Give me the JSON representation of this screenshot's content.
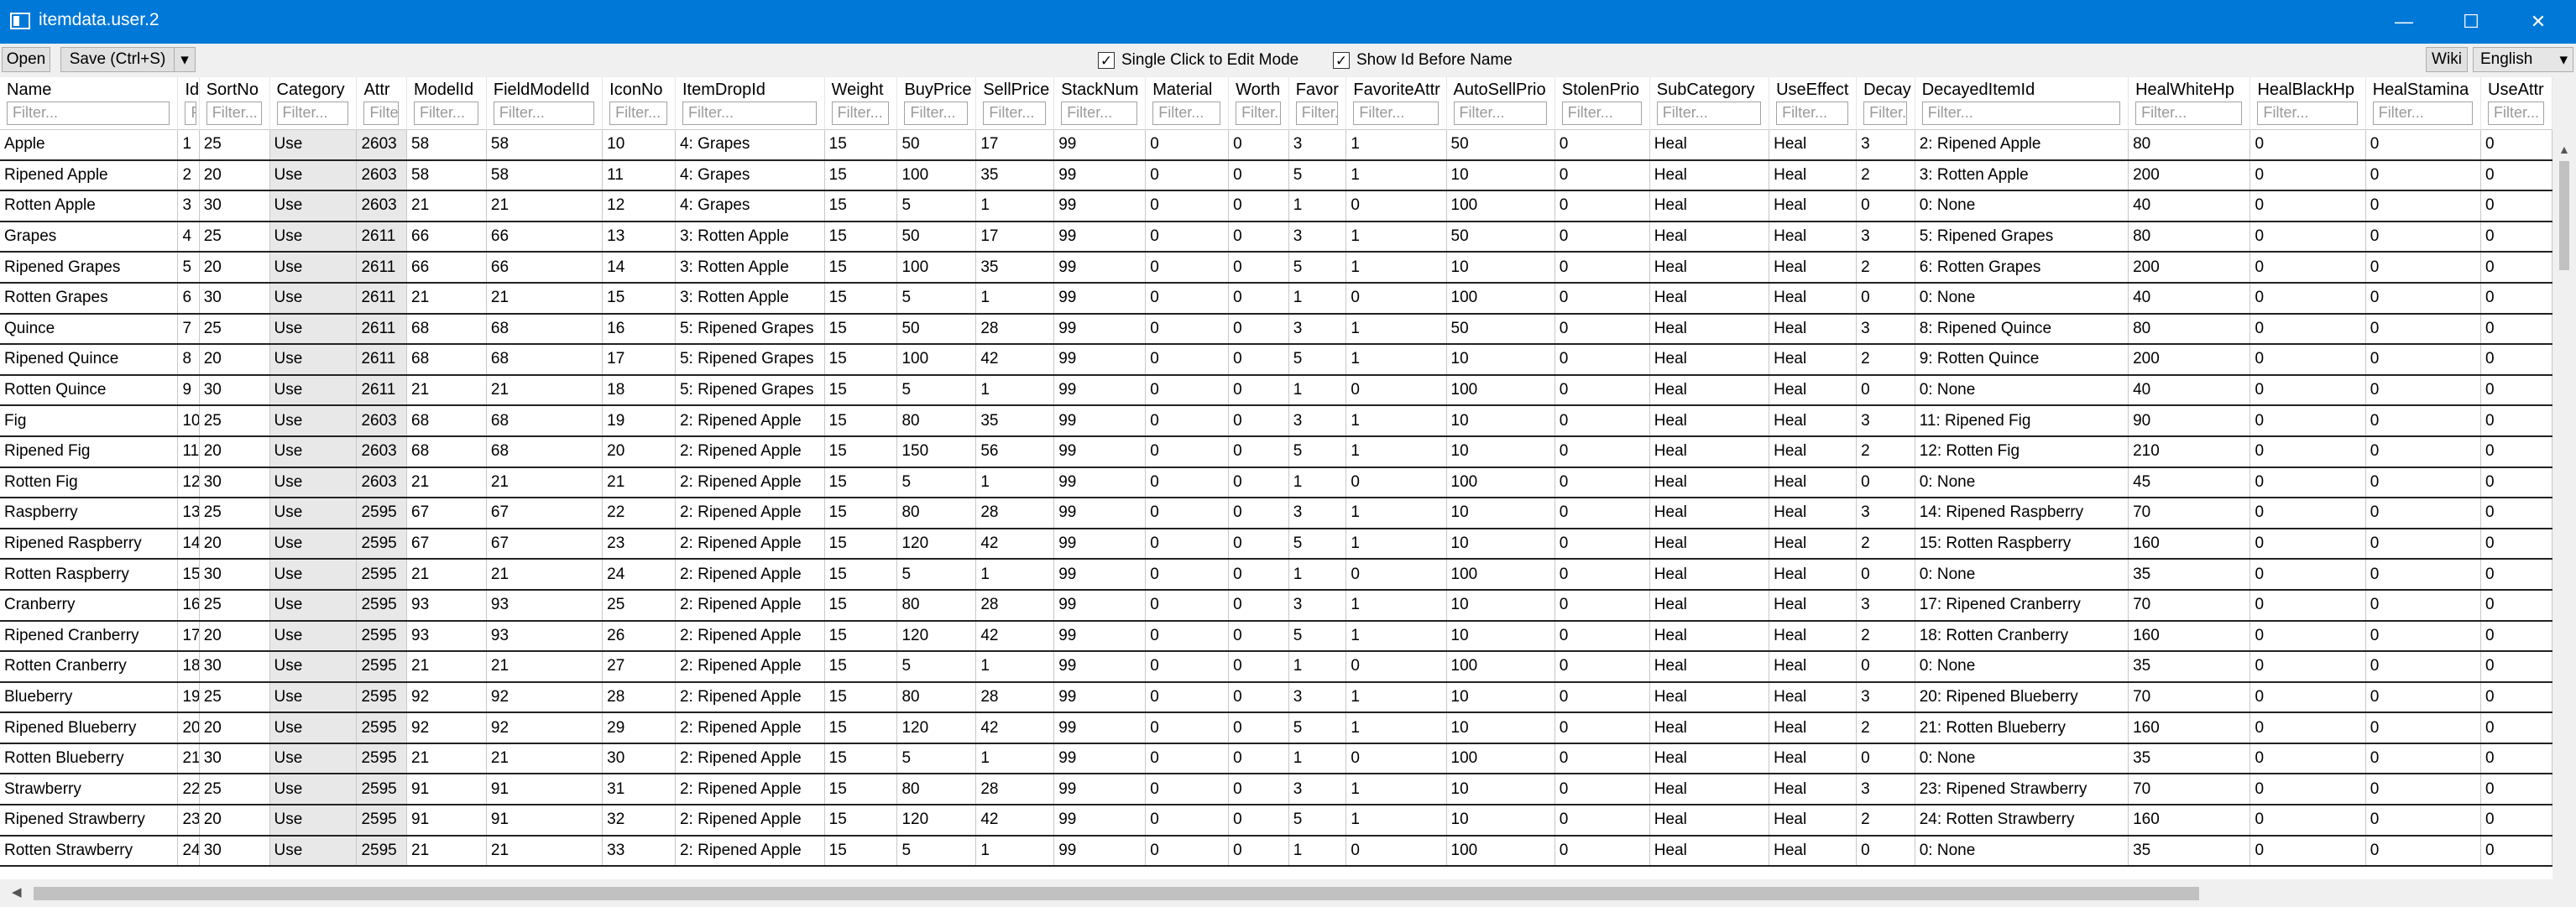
{
  "window": {
    "title": "itemdata.user.2",
    "minimize_icon": "minimize-icon",
    "maximize_icon": "maximize-icon",
    "close_icon": "close-icon",
    "minimize": "—",
    "maximize": "☐",
    "close": "✕"
  },
  "toolbar": {
    "open_label": "Open",
    "save_label": "Save (Ctrl+S)",
    "save_dropdown": "▾",
    "single_click_label": "Single Click to Edit Mode",
    "single_click_checked": "✓",
    "show_id_label": "Show Id Before Name",
    "show_id_checked": "✓",
    "wiki_label": "Wiki",
    "language_value": "English",
    "language_dropdown": "▾"
  },
  "grid": {
    "filter_placeholder": "Filter...",
    "columns": [
      "Name",
      "Id",
      "SortNo",
      "Category",
      "Attr",
      "ModelId",
      "FieldModelId",
      "IconNo",
      "ItemDropId",
      "Weight",
      "BuyPrice",
      "SellPrice",
      "StackNum",
      "Material",
      "Worth",
      "Favor",
      "FavoriteAttr",
      "AutoSellPrio",
      "StolenPrio",
      "SubCategory",
      "UseEffect",
      "Decay",
      "DecayedItemId",
      "HealWhiteHp",
      "HealBlackHp",
      "HealStamina",
      "UseAttr"
    ],
    "rows": [
      [
        "Apple",
        "1",
        "25",
        "Use",
        "2603",
        "58",
        "58",
        "10",
        "4: Grapes",
        "15",
        "50",
        "17",
        "99",
        "0",
        "0",
        "3",
        "1",
        "50",
        "0",
        "Heal",
        "Heal",
        "3",
        "2: Ripened Apple",
        "80",
        "0",
        "0",
        "0"
      ],
      [
        "Ripened Apple",
        "2",
        "20",
        "Use",
        "2603",
        "58",
        "58",
        "11",
        "4: Grapes",
        "15",
        "100",
        "35",
        "99",
        "0",
        "0",
        "5",
        "1",
        "10",
        "0",
        "Heal",
        "Heal",
        "2",
        "3: Rotten Apple",
        "200",
        "0",
        "0",
        "0"
      ],
      [
        "Rotten Apple",
        "3",
        "30",
        "Use",
        "2603",
        "21",
        "21",
        "12",
        "4: Grapes",
        "15",
        "5",
        "1",
        "99",
        "0",
        "0",
        "1",
        "0",
        "100",
        "0",
        "Heal",
        "Heal",
        "0",
        "0: None",
        "40",
        "0",
        "0",
        "0"
      ],
      [
        "Grapes",
        "4",
        "25",
        "Use",
        "2611",
        "66",
        "66",
        "13",
        "3: Rotten Apple",
        "15",
        "50",
        "17",
        "99",
        "0",
        "0",
        "3",
        "1",
        "50",
        "0",
        "Heal",
        "Heal",
        "3",
        "5: Ripened Grapes",
        "80",
        "0",
        "0",
        "0"
      ],
      [
        "Ripened Grapes",
        "5",
        "20",
        "Use",
        "2611",
        "66",
        "66",
        "14",
        "3: Rotten Apple",
        "15",
        "100",
        "35",
        "99",
        "0",
        "0",
        "5",
        "1",
        "10",
        "0",
        "Heal",
        "Heal",
        "2",
        "6: Rotten Grapes",
        "200",
        "0",
        "0",
        "0"
      ],
      [
        "Rotten Grapes",
        "6",
        "30",
        "Use",
        "2611",
        "21",
        "21",
        "15",
        "3: Rotten Apple",
        "15",
        "5",
        "1",
        "99",
        "0",
        "0",
        "1",
        "0",
        "100",
        "0",
        "Heal",
        "Heal",
        "0",
        "0: None",
        "40",
        "0",
        "0",
        "0"
      ],
      [
        "Quince",
        "7",
        "25",
        "Use",
        "2611",
        "68",
        "68",
        "16",
        "5: Ripened Grapes",
        "15",
        "50",
        "28",
        "99",
        "0",
        "0",
        "3",
        "1",
        "50",
        "0",
        "Heal",
        "Heal",
        "3",
        "8: Ripened Quince",
        "80",
        "0",
        "0",
        "0"
      ],
      [
        "Ripened Quince",
        "8",
        "20",
        "Use",
        "2611",
        "68",
        "68",
        "17",
        "5: Ripened Grapes",
        "15",
        "100",
        "42",
        "99",
        "0",
        "0",
        "5",
        "1",
        "10",
        "0",
        "Heal",
        "Heal",
        "2",
        "9: Rotten Quince",
        "200",
        "0",
        "0",
        "0"
      ],
      [
        "Rotten Quince",
        "9",
        "30",
        "Use",
        "2611",
        "21",
        "21",
        "18",
        "5: Ripened Grapes",
        "15",
        "5",
        "1",
        "99",
        "0",
        "0",
        "1",
        "0",
        "100",
        "0",
        "Heal",
        "Heal",
        "0",
        "0: None",
        "40",
        "0",
        "0",
        "0"
      ],
      [
        "Fig",
        "10",
        "25",
        "Use",
        "2603",
        "68",
        "68",
        "19",
        "2: Ripened Apple",
        "15",
        "80",
        "35",
        "99",
        "0",
        "0",
        "3",
        "1",
        "10",
        "0",
        "Heal",
        "Heal",
        "3",
        "11: Ripened Fig",
        "90",
        "0",
        "0",
        "0"
      ],
      [
        "Ripened Fig",
        "11",
        "20",
        "Use",
        "2603",
        "68",
        "68",
        "20",
        "2: Ripened Apple",
        "15",
        "150",
        "56",
        "99",
        "0",
        "0",
        "5",
        "1",
        "10",
        "0",
        "Heal",
        "Heal",
        "2",
        "12: Rotten Fig",
        "210",
        "0",
        "0",
        "0"
      ],
      [
        "Rotten Fig",
        "12",
        "30",
        "Use",
        "2603",
        "21",
        "21",
        "21",
        "2: Ripened Apple",
        "15",
        "5",
        "1",
        "99",
        "0",
        "0",
        "1",
        "0",
        "100",
        "0",
        "Heal",
        "Heal",
        "0",
        "0: None",
        "45",
        "0",
        "0",
        "0"
      ],
      [
        "Raspberry",
        "13",
        "25",
        "Use",
        "2595",
        "67",
        "67",
        "22",
        "2: Ripened Apple",
        "15",
        "80",
        "28",
        "99",
        "0",
        "0",
        "3",
        "1",
        "10",
        "0",
        "Heal",
        "Heal",
        "3",
        "14: Ripened Raspberry",
        "70",
        "0",
        "0",
        "0"
      ],
      [
        "Ripened Raspberry",
        "14",
        "20",
        "Use",
        "2595",
        "67",
        "67",
        "23",
        "2: Ripened Apple",
        "15",
        "120",
        "42",
        "99",
        "0",
        "0",
        "5",
        "1",
        "10",
        "0",
        "Heal",
        "Heal",
        "2",
        "15: Rotten Raspberry",
        "160",
        "0",
        "0",
        "0"
      ],
      [
        "Rotten Raspberry",
        "15",
        "30",
        "Use",
        "2595",
        "21",
        "21",
        "24",
        "2: Ripened Apple",
        "15",
        "5",
        "1",
        "99",
        "0",
        "0",
        "1",
        "0",
        "100",
        "0",
        "Heal",
        "Heal",
        "0",
        "0: None",
        "35",
        "0",
        "0",
        "0"
      ],
      [
        "Cranberry",
        "16",
        "25",
        "Use",
        "2595",
        "93",
        "93",
        "25",
        "2: Ripened Apple",
        "15",
        "80",
        "28",
        "99",
        "0",
        "0",
        "3",
        "1",
        "10",
        "0",
        "Heal",
        "Heal",
        "3",
        "17: Ripened Cranberry",
        "70",
        "0",
        "0",
        "0"
      ],
      [
        "Ripened Cranberry",
        "17",
        "20",
        "Use",
        "2595",
        "93",
        "93",
        "26",
        "2: Ripened Apple",
        "15",
        "120",
        "42",
        "99",
        "0",
        "0",
        "5",
        "1",
        "10",
        "0",
        "Heal",
        "Heal",
        "2",
        "18: Rotten Cranberry",
        "160",
        "0",
        "0",
        "0"
      ],
      [
        "Rotten Cranberry",
        "18",
        "30",
        "Use",
        "2595",
        "21",
        "21",
        "27",
        "2: Ripened Apple",
        "15",
        "5",
        "1",
        "99",
        "0",
        "0",
        "1",
        "0",
        "100",
        "0",
        "Heal",
        "Heal",
        "0",
        "0: None",
        "35",
        "0",
        "0",
        "0"
      ],
      [
        "Blueberry",
        "19",
        "25",
        "Use",
        "2595",
        "92",
        "92",
        "28",
        "2: Ripened Apple",
        "15",
        "80",
        "28",
        "99",
        "0",
        "0",
        "3",
        "1",
        "10",
        "0",
        "Heal",
        "Heal",
        "3",
        "20: Ripened Blueberry",
        "70",
        "0",
        "0",
        "0"
      ],
      [
        "Ripened Blueberry",
        "20",
        "20",
        "Use",
        "2595",
        "92",
        "92",
        "29",
        "2: Ripened Apple",
        "15",
        "120",
        "42",
        "99",
        "0",
        "0",
        "5",
        "1",
        "10",
        "0",
        "Heal",
        "Heal",
        "2",
        "21: Rotten Blueberry",
        "160",
        "0",
        "0",
        "0"
      ],
      [
        "Rotten Blueberry",
        "21",
        "30",
        "Use",
        "2595",
        "21",
        "21",
        "30",
        "2: Ripened Apple",
        "15",
        "5",
        "1",
        "99",
        "0",
        "0",
        "1",
        "0",
        "100",
        "0",
        "Heal",
        "Heal",
        "0",
        "0: None",
        "35",
        "0",
        "0",
        "0"
      ],
      [
        "Strawberry",
        "22",
        "25",
        "Use",
        "2595",
        "91",
        "91",
        "31",
        "2: Ripened Apple",
        "15",
        "80",
        "28",
        "99",
        "0",
        "0",
        "3",
        "1",
        "10",
        "0",
        "Heal",
        "Heal",
        "3",
        "23: Ripened Strawberry",
        "70",
        "0",
        "0",
        "0"
      ],
      [
        "Ripened Strawberry",
        "23",
        "20",
        "Use",
        "2595",
        "91",
        "91",
        "32",
        "2: Ripened Apple",
        "15",
        "120",
        "42",
        "99",
        "0",
        "0",
        "5",
        "1",
        "10",
        "0",
        "Heal",
        "Heal",
        "2",
        "24: Rotten Strawberry",
        "160",
        "0",
        "0",
        "0"
      ],
      [
        "Rotten Strawberry",
        "24",
        "30",
        "Use",
        "2595",
        "21",
        "21",
        "33",
        "2: Ripened Apple",
        "15",
        "5",
        "1",
        "99",
        "0",
        "0",
        "1",
        "0",
        "100",
        "0",
        "Heal",
        "Heal",
        "0",
        "0: None",
        "35",
        "0",
        "0",
        "0"
      ]
    ]
  }
}
